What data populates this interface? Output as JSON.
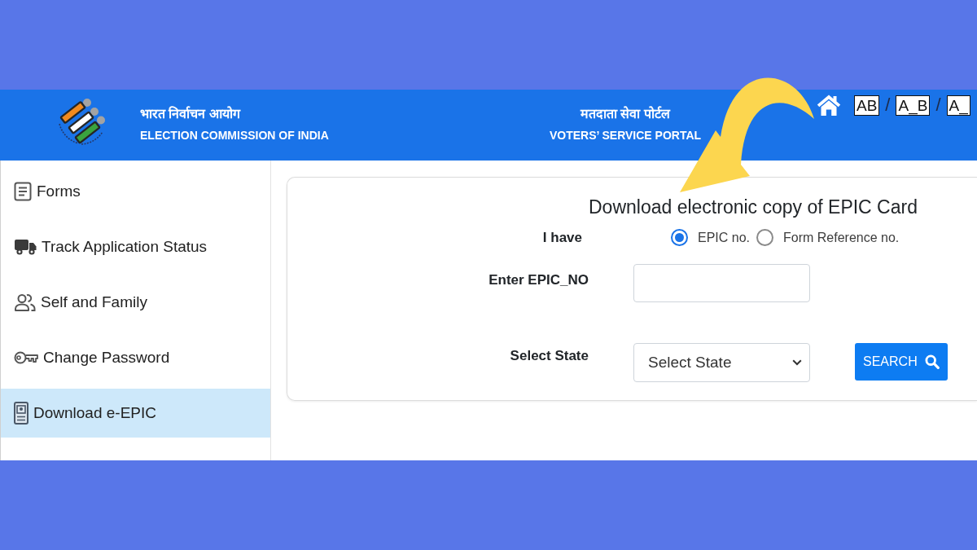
{
  "header": {
    "org_name_hindi": "भारत निर्वाचन आयोग",
    "org_name": "ELECTION COMMISSION OF INDIA",
    "portal_name_hindi": "मतदाता सेवा पोर्टल",
    "portal_name": "VOTERS’ SERVICE PORTAL",
    "text_size_options": [
      {
        "label": "AB",
        "separator": "/"
      },
      {
        "label": "A_B",
        "separator": "/"
      },
      {
        "label": "A_"
      }
    ]
  },
  "sidebar": {
    "items": [
      {
        "label": "Forms",
        "selected": false
      },
      {
        "label": "Track Application Status",
        "selected": false
      },
      {
        "label": "Self and Family",
        "selected": false
      },
      {
        "label": "Change Password",
        "selected": false
      },
      {
        "label": "Download e-EPIC",
        "selected": true
      }
    ]
  },
  "form": {
    "title": "Download electronic copy of EPIC Card",
    "fields": [
      {
        "kind": "radio",
        "label": "I have",
        "options": [
          {
            "label": "EPIC no.",
            "selected": true
          },
          {
            "label": "Form Reference no.",
            "selected": false
          }
        ]
      },
      {
        "kind": "text",
        "label": "Enter EPIC_NO"
      },
      {
        "kind": "select",
        "label": "Select State",
        "value": "Select State"
      }
    ],
    "search_button": "SEARCH"
  }
}
